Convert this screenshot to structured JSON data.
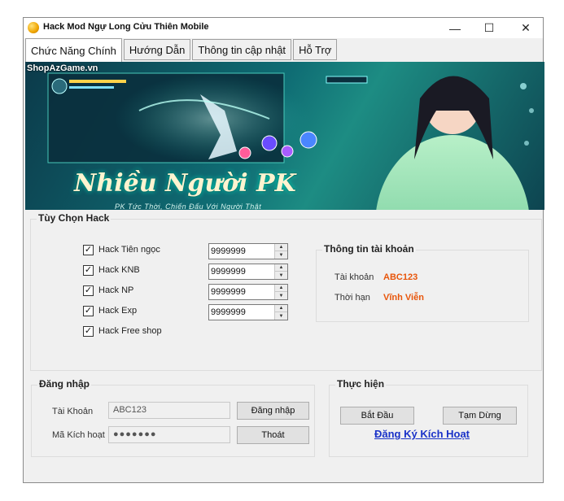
{
  "window": {
    "title": "Hack Mod Ngự Long Cửu Thiên Mobile",
    "minimize": "—",
    "maximize": "☐",
    "close": "✕"
  },
  "tabs": [
    {
      "label": "Chức Năng Chính",
      "active": true
    },
    {
      "label": "Hướng Dẫn",
      "active": false
    },
    {
      "label": "Thông tin cập nhật",
      "active": false
    },
    {
      "label": "Hỗ Trợ",
      "active": false
    }
  ],
  "banner": {
    "watermark": "ShopAzGame.vn",
    "title": "Nhiều Người PK",
    "subtitle": "PK Tức Thời, Chiến Đấu Với Người Thật"
  },
  "hack_options": {
    "title": "Tùy Chọn Hack",
    "items": [
      {
        "label": "Hack Tiên ngọc",
        "checked": true,
        "value": "9999999"
      },
      {
        "label": "Hack KNB",
        "checked": true,
        "value": "9999999"
      },
      {
        "label": "Hack NP",
        "checked": true,
        "value": "9999999"
      },
      {
        "label": "Hack Exp",
        "checked": true,
        "value": "9999999"
      },
      {
        "label": "Hack Free shop",
        "checked": true
      }
    ]
  },
  "account_info": {
    "title": "Thông tin tài khoản",
    "account_label": "Tài khoản",
    "account_value": "ABC123",
    "expiry_label": "Thời hạn",
    "expiry_value": "Vĩnh Viễn",
    "value_color": "#e8550a"
  },
  "login": {
    "title": "Đăng nhập",
    "account_label": "Tài Khoản",
    "account_value": "ABC123",
    "code_label": "Mã Kích hoạt",
    "code_value": "●●●●●●●",
    "login_button": "Đăng nhập",
    "exit_button": "Thoát"
  },
  "actions": {
    "title": "Thực hiện",
    "start_button": "Bắt Đầu",
    "pause_button": "Tạm Dừng",
    "register_link": "Đăng Ký Kích Hoạt",
    "link_color": "#1a32c8"
  }
}
